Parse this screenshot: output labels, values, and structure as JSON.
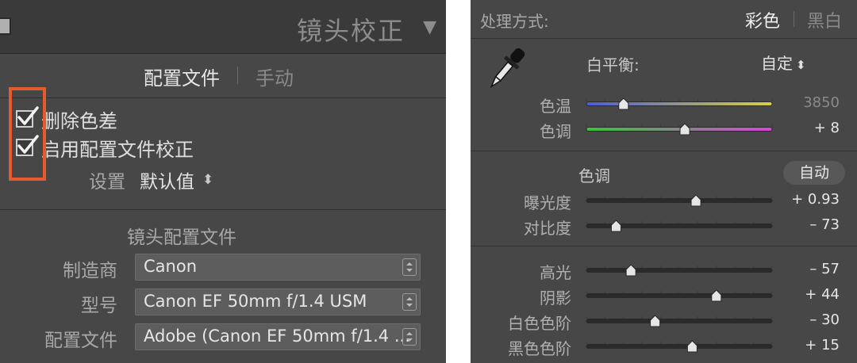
{
  "lens_panel": {
    "title": "镜头校正",
    "tabs": [
      {
        "label": "配置文件",
        "active": true
      },
      {
        "label": "手动",
        "active": false
      }
    ],
    "checkboxes": [
      {
        "label": "删除色差",
        "checked": true
      },
      {
        "label": "启用配置文件校正",
        "checked": true
      }
    ],
    "setting": {
      "label": "设置",
      "value": "默认值"
    },
    "section_title": "镜头配置文件",
    "fields": [
      {
        "label": "制造商",
        "value": "Canon"
      },
      {
        "label": "型号",
        "value": "Canon EF 50mm f/1.4 USM"
      },
      {
        "label": "配置文件",
        "value": "Adobe (Canon EF 50mm f/1.4 ..."
      }
    ]
  },
  "basic_panel": {
    "treatment": {
      "label": "处理方式:",
      "color": "彩色",
      "bw": "黑白"
    },
    "white_balance": {
      "label": "白平衡:",
      "value": "自定"
    },
    "wb_sliders": [
      {
        "label": "色温",
        "value": "3850",
        "position": 0.2,
        "gradient": [
          "#4b5bd8",
          "#d8d040"
        ]
      },
      {
        "label": "色调",
        "value": "+ 8",
        "position": 0.53,
        "gradient": [
          "#38c43a",
          "#d646d6"
        ]
      }
    ],
    "tone": {
      "title": "色调",
      "auto_label": "自动"
    },
    "tone_sliders": [
      {
        "label": "曝光度",
        "value": "+ 0.93",
        "position": 0.59
      },
      {
        "label": "对比度",
        "value": "– 73",
        "position": 0.16
      }
    ],
    "presence_sliders": [
      {
        "label": "高光",
        "value": "– 57",
        "position": 0.24
      },
      {
        "label": "阴影",
        "value": "+ 44",
        "position": 0.7
      },
      {
        "label": "白色色阶",
        "value": "– 30",
        "position": 0.37
      },
      {
        "label": "黑色色阶",
        "value": "+ 15",
        "position": 0.57
      }
    ]
  },
  "colors": {
    "panel_bg": "#474747",
    "highlight_frame": "#e65a2b"
  }
}
